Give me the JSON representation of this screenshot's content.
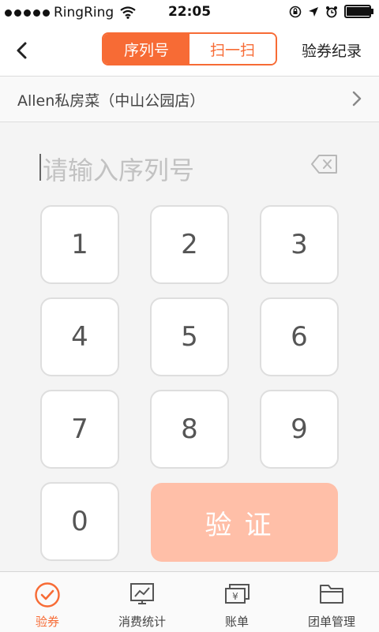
{
  "status": {
    "carrier": "RingRing",
    "time": "22:05",
    "battery_level": 0.95
  },
  "nav": {
    "segments": [
      "序列号",
      "扫一扫"
    ],
    "active_segment": 0,
    "right_action": "验券纪录"
  },
  "store": {
    "name": "Allen私房菜（中山公园店）"
  },
  "input": {
    "placeholder": "请输入序列号",
    "value": ""
  },
  "keypad": {
    "keys": [
      "1",
      "2",
      "3",
      "4",
      "5",
      "6",
      "7",
      "8",
      "9",
      "0"
    ],
    "verify_label": "验证"
  },
  "tabs": [
    {
      "label": "验券",
      "icon": "verify-icon",
      "active": true
    },
    {
      "label": "消费统计",
      "icon": "chart-icon",
      "active": false
    },
    {
      "label": "账单",
      "icon": "bill-icon",
      "active": false
    },
    {
      "label": "团单管理",
      "icon": "folder-icon",
      "active": false
    }
  ],
  "colors": {
    "accent": "#f76b35",
    "verify_disabled": "#ffbfa8"
  }
}
